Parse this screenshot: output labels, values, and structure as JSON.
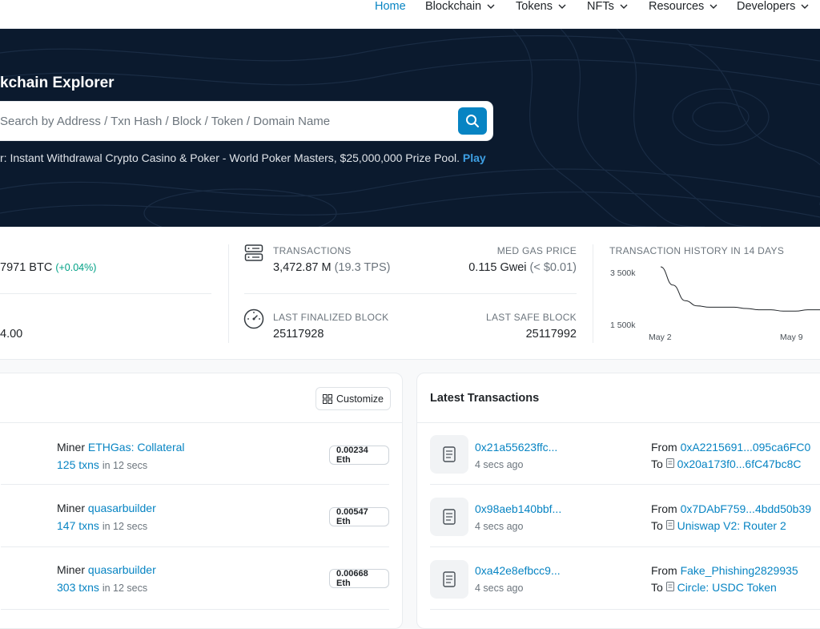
{
  "nav": {
    "items": [
      {
        "label": "Home",
        "active": true
      },
      {
        "label": "Blockchain"
      },
      {
        "label": "Tokens"
      },
      {
        "label": "NFTs"
      },
      {
        "label": "Resources"
      },
      {
        "label": "Developers"
      }
    ]
  },
  "hero": {
    "title": "kchain Explorer",
    "search_placeholder": "Search by Address / Txn Hash / Block / Token / Domain Name",
    "sponsor_text": "r: Instant Withdrawal Crypto Casino & Poker - World Poker Masters, $25,000,000 Prize Pool.",
    "sponsor_link": "Play"
  },
  "stats": {
    "price_value": "7971 BTC",
    "price_change": "(+0.04%)",
    "market_value": "4.00",
    "transactions_label": "TRANSACTIONS",
    "transactions_value": "3,472.87 M",
    "transactions_tps": "(19.3 TPS)",
    "gas_label": "MED GAS PRICE",
    "gas_value": "0.115 Gwei",
    "gas_usd": "(< $0.01)",
    "finalized_label": "LAST FINALIZED BLOCK",
    "finalized_value": "25117928",
    "safe_label": "LAST SAFE BLOCK",
    "safe_value": "25117992",
    "history_label": "TRANSACTION HISTORY IN 14 DAYS"
  },
  "chart_data": {
    "type": "line",
    "title": "TRANSACTION HISTORY IN 14 DAYS",
    "y_ticks": [
      "3 500k",
      "1 500k"
    ],
    "x_ticks": [
      "May 2",
      "May 9"
    ],
    "series": [
      {
        "values": [
          3500000,
          2800000,
          2200000,
          2000000,
          1950000,
          1950000,
          1950000,
          1900000,
          1850000,
          1850000,
          1800000,
          1800000,
          1850000,
          1850000
        ]
      }
    ],
    "ylim": [
      1500000,
      3500000
    ]
  },
  "blocks": {
    "customize_label": "Customize",
    "rows": [
      {
        "miner_prefix": "Miner",
        "miner": "ETHGas: Collateral",
        "txns": "125 txns",
        "time": "in 12 secs",
        "reward": "0.00234 Eth"
      },
      {
        "miner_prefix": "Miner",
        "miner": "quasarbuilder",
        "txns": "147 txns",
        "time": "in 12 secs",
        "reward": "0.00547 Eth"
      },
      {
        "miner_prefix": "Miner",
        "miner": "quasarbuilder",
        "txns": "303 txns",
        "time": "in 12 secs",
        "reward": "0.00668 Eth"
      }
    ]
  },
  "transactions": {
    "title": "Latest Transactions",
    "rows": [
      {
        "hash": "0x21a55623ffc...",
        "age": "4 secs ago",
        "from_label": "From",
        "from": "0xA2215691...095ca6FC0",
        "to_label": "To",
        "to": "0x20a173f0...6fC47bc8C"
      },
      {
        "hash": "0x98aeb140bbf...",
        "age": "4 secs ago",
        "from_label": "From",
        "from": "0x7DAbF759...4bdd50b39",
        "to_label": "To",
        "to": "Uniswap V2: Router 2"
      },
      {
        "hash": "0xa42e8efbcc9...",
        "age": "4 secs ago",
        "from_label": "From",
        "from": "Fake_Phishing2829935",
        "to_label": "To",
        "to": "Circle: USDC Token"
      }
    ]
  },
  "colors": {
    "accent": "#0784c3",
    "hero_bg": "#0b1a2e",
    "positive": "#00a186"
  }
}
